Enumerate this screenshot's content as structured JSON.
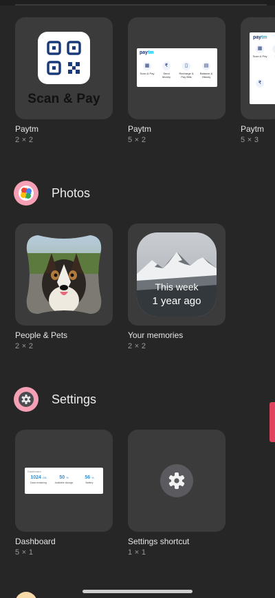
{
  "widgets_row1": [
    {
      "app": "Paytm",
      "size": "2 × 2",
      "preview_text": "Scan & Pay"
    },
    {
      "app": "Paytm",
      "size": "5 × 2",
      "logo": "paytm",
      "actions": [
        "Scan & Pay",
        "Send Money",
        "Recharge & Pay Bills",
        "Balance & History"
      ]
    },
    {
      "app": "Paytm",
      "size": "5 × 3",
      "logo": "paytm",
      "actions": [
        "Scan & Pay",
        "Se"
      ]
    }
  ],
  "sections": {
    "photos": {
      "title": "Photos",
      "icon": "photos-pinwheel-icon",
      "widgets": [
        {
          "label": "People & Pets",
          "size": "2 × 2"
        },
        {
          "label": "Your memories",
          "size": "2 × 2",
          "overlay_line1": "This week",
          "overlay_line2": "1 year ago"
        }
      ]
    },
    "settings": {
      "title": "Settings",
      "icon": "gear-icon",
      "widgets": [
        {
          "label": "Dashboard",
          "size": "5 × 1",
          "dashboard_title": "Dashboard",
          "stats": [
            {
              "value": "1024",
              "unit": "GB",
              "label": "Data remaining"
            },
            {
              "value": "50",
              "unit": "%",
              "label": "Available storage"
            },
            {
              "value": "56",
              "unit": "%",
              "label": "Battery"
            }
          ]
        },
        {
          "label": "Settings shortcut",
          "size": "1 × 1"
        }
      ]
    }
  },
  "colors": {
    "background": "#262626",
    "tile": "#3b3b3b",
    "accent_scroll": "#e0445f",
    "settings_icon_bg": "#f5a0b4"
  }
}
